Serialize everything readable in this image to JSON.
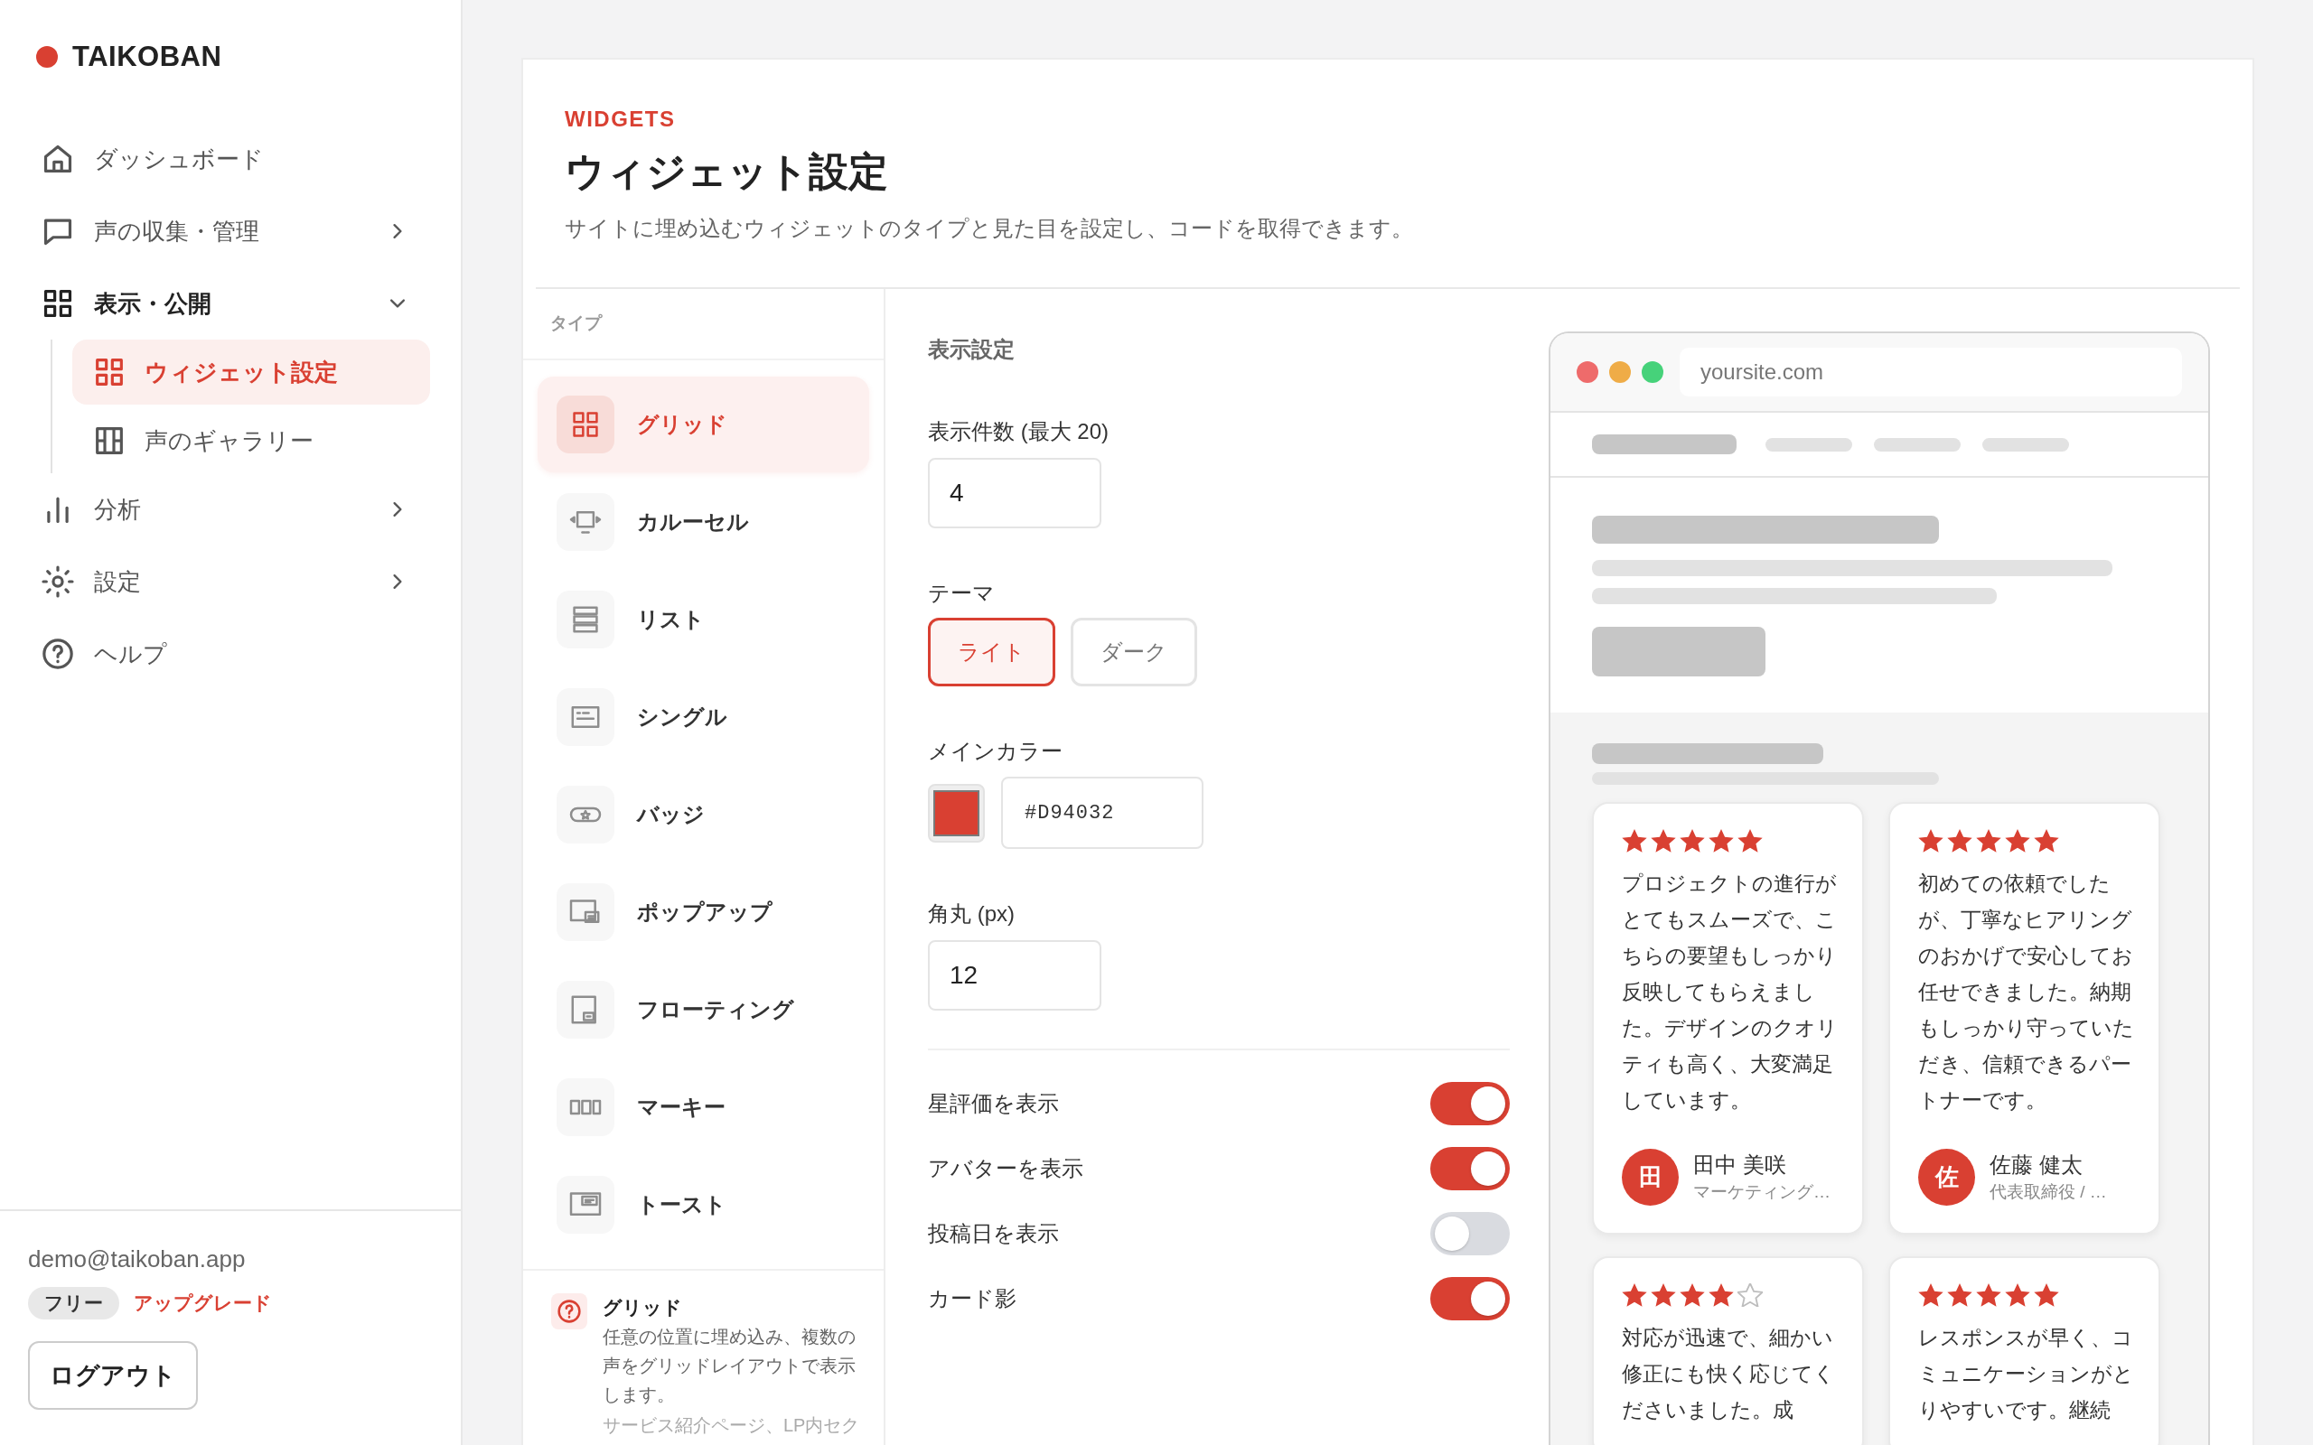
{
  "sidebar": {
    "brand": "TAIKOBAN",
    "nav": [
      {
        "label": "ダッシュボード",
        "selected": false
      },
      {
        "label": "声の収集・管理",
        "selected": false,
        "expanded": false
      },
      {
        "label": "表示・公開",
        "selected": false,
        "expanded": true,
        "children": [
          {
            "label": "ウィジェット設定",
            "selected": true
          },
          {
            "label": "声のギャラリー",
            "selected": false
          }
        ]
      },
      {
        "label": "分析",
        "selected": false,
        "expanded": false
      },
      {
        "label": "設定",
        "selected": false,
        "expanded": false
      },
      {
        "label": "ヘルプ",
        "selected": false
      }
    ],
    "account": {
      "email": "demo@taikoban.app",
      "plan": "フリー",
      "upgrade": "アップグレード",
      "logout": "ログアウト"
    }
  },
  "header": {
    "eyebrow": "WIDGETS",
    "title": "ウィジェット設定",
    "subtitle": "サイトに埋め込むウィジェットのタイプと見た目を設定し、コードを取得できます。"
  },
  "types": {
    "heading": "タイプ",
    "items": [
      {
        "label": "グリッド",
        "selected": true
      },
      {
        "label": "カルーセル",
        "selected": false
      },
      {
        "label": "リスト",
        "selected": false
      },
      {
        "label": "シングル",
        "selected": false
      },
      {
        "label": "バッジ",
        "selected": false
      },
      {
        "label": "ポップアップ",
        "selected": false
      },
      {
        "label": "フローティング",
        "selected": false
      },
      {
        "label": "マーキー",
        "selected": false
      },
      {
        "label": "トースト",
        "selected": false
      }
    ],
    "info": {
      "title": "グリッド",
      "description": "任意の位置に埋め込み、複数の声をグリッドレイアウトで表示します。",
      "note": "サービス紹介ページ、LP内セク"
    }
  },
  "settings": {
    "heading": "表示設定",
    "count": {
      "label": "表示件数 (最大 20)",
      "value": "4"
    },
    "theme": {
      "label": "テーマ",
      "options": [
        {
          "label": "ライト",
          "selected": true
        },
        {
          "label": "ダーク",
          "selected": false
        }
      ]
    },
    "color": {
      "label": "メインカラー",
      "value": "#D94032"
    },
    "radius": {
      "label": "角丸 (px)",
      "value": "12"
    },
    "toggles": [
      {
        "label": "星評価を表示",
        "on": true
      },
      {
        "label": "アバターを表示",
        "on": true
      },
      {
        "label": "投稿日を表示",
        "on": false
      },
      {
        "label": "カード影",
        "on": true
      }
    ]
  },
  "preview": {
    "url": "yoursite.com",
    "reviews": [
      {
        "stars": 5,
        "text": "プロジェクトの進行がとてもスムーズで、こちらの要望もしっかり反映してもらえました。デザインのクオリティも高く、大変満足しています。",
        "initial": "田",
        "name": "田中 美咲",
        "role": "マーケティング…"
      },
      {
        "stars": 5,
        "text": "初めての依頼でしたが、丁寧なヒアリングのおかげで安心してお任せできました。納期もしっかり守っていただき、信頼できるパートナーです。",
        "initial": "佐",
        "name": "佐藤 健太",
        "role": "代表取締役 / …"
      },
      {
        "stars": 4,
        "text": "対応が迅速で、細かい修正にも快く応じてくださいました。成"
      },
      {
        "stars": 5,
        "text": "レスポンスが早く、コミュニケーションがとりやすいです。継続"
      }
    ]
  }
}
